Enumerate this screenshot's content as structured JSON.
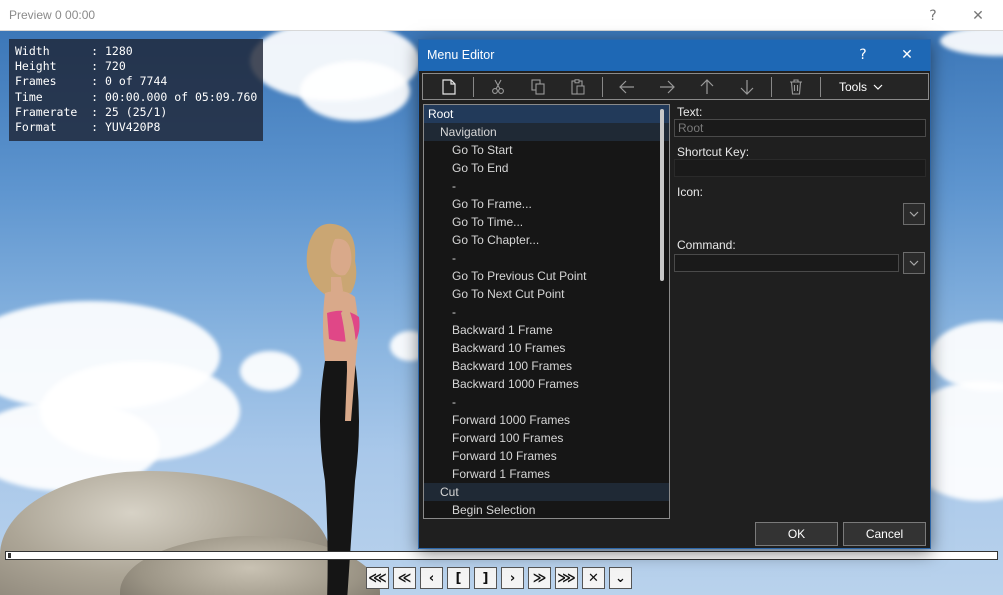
{
  "preview": {
    "title": "Preview  0  00:00",
    "help_glyph": "?",
    "close_glyph": "✕"
  },
  "info": {
    "rows": [
      "Width      : 1280",
      "Height     : 720",
      "Frames     : 0 of 7744",
      "Time       : 00:00.000 of 05:09.760",
      "Framerate  : 25 (25/1)",
      "Format     : YUV420P8"
    ]
  },
  "transport": {
    "buttons": [
      {
        "name": "jump-start-button",
        "glyph": "⋘"
      },
      {
        "name": "step-back-button",
        "glyph": "≪"
      },
      {
        "name": "prev-frame-button",
        "glyph": "‹"
      },
      {
        "name": "mark-in-button",
        "glyph": "["
      },
      {
        "name": "mark-out-button",
        "glyph": "]"
      },
      {
        "name": "next-frame-button",
        "glyph": "›"
      },
      {
        "name": "step-forward-button",
        "glyph": "≫"
      },
      {
        "name": "jump-end-button",
        "glyph": "⋙"
      },
      {
        "name": "clear-button",
        "glyph": "✕"
      },
      {
        "name": "menu-button",
        "glyph": "⌄"
      }
    ]
  },
  "menu_editor": {
    "title": "Menu Editor",
    "help_glyph": "?",
    "close_glyph": "✕",
    "toolbar": {
      "tools_label": "Tools"
    },
    "tree": [
      {
        "label": "Root",
        "level": 0,
        "selected": true
      },
      {
        "label": "Navigation",
        "level": 1,
        "group": true
      },
      {
        "label": "Go To Start",
        "level": 2
      },
      {
        "label": "Go To End",
        "level": 2
      },
      {
        "label": "-",
        "level": 2
      },
      {
        "label": "Go To Frame...",
        "level": 2
      },
      {
        "label": "Go To Time...",
        "level": 2
      },
      {
        "label": "Go To Chapter...",
        "level": 2
      },
      {
        "label": "-",
        "level": 2
      },
      {
        "label": "Go To Previous Cut Point",
        "level": 2
      },
      {
        "label": "Go To Next Cut Point",
        "level": 2
      },
      {
        "label": "-",
        "level": 2
      },
      {
        "label": "Backward 1 Frame",
        "level": 2
      },
      {
        "label": "Backward 10 Frames",
        "level": 2
      },
      {
        "label": "Backward 100 Frames",
        "level": 2
      },
      {
        "label": "Backward 1000 Frames",
        "level": 2
      },
      {
        "label": "-",
        "level": 2
      },
      {
        "label": "Forward 1000 Frames",
        "level": 2
      },
      {
        "label": "Forward 100 Frames",
        "level": 2
      },
      {
        "label": "Forward 10 Frames",
        "level": 2
      },
      {
        "label": "Forward 1 Frames",
        "level": 2
      },
      {
        "label": "Cut",
        "level": 1,
        "group": true
      },
      {
        "label": "Begin Selection",
        "level": 2
      }
    ],
    "fields": {
      "text_label": "Text:",
      "text_value": "Root",
      "shortcut_label": "Shortcut Key:",
      "shortcut_value": "",
      "icon_label": "Icon:",
      "command_label": "Command:",
      "command_value": ""
    },
    "ok_label": "OK",
    "cancel_label": "Cancel"
  },
  "colors": {
    "dialog_title_bg": "#1e68b5",
    "dialog_bg": "#1f1f1f",
    "selected_bg": "#223a5a"
  }
}
